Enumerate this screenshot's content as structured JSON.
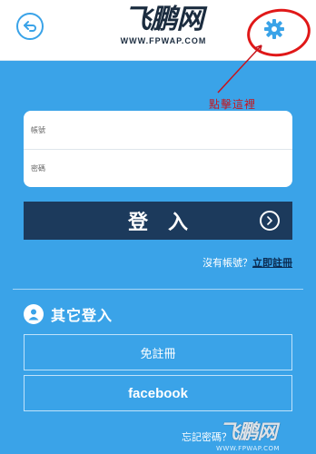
{
  "header": {
    "logo_main": "飞鹏网",
    "logo_sub": "WWW.FPWAP.COM",
    "back_icon": "back-arrow-icon",
    "settings_icon": "gear-icon"
  },
  "annotation": {
    "text": "點擊這裡"
  },
  "form": {
    "account_placeholder": "帳號",
    "password_placeholder": "密碼"
  },
  "login_button": {
    "label": "登入",
    "icon": "chevron-right-circle-icon"
  },
  "register": {
    "prompt": "沒有帳號？",
    "link": "立即註冊"
  },
  "other_login": {
    "title": "其它登入",
    "icon": "user-icon",
    "no_register_label": "免註冊",
    "facebook_label": "facebook"
  },
  "forgot": {
    "text": "忘記密碼？"
  },
  "watermark": {
    "main": "飞鹏网",
    "sub": "WWW.FPWAP.COM"
  },
  "colors": {
    "background": "#3aa3e8",
    "login_button": "#1c3a5c",
    "annotation_red": "#e01818"
  }
}
